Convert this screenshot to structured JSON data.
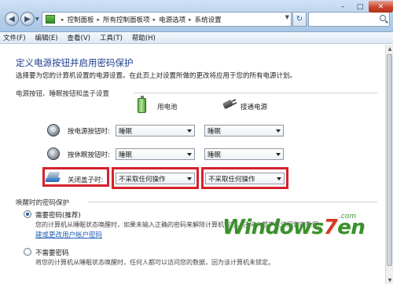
{
  "window": {
    "breadcrumbs": [
      "控制面板",
      "所有控制面板项",
      "电源选项",
      "系统设置"
    ],
    "controls": {
      "minimize": "–",
      "maximize": "□",
      "close": "✕"
    }
  },
  "menu": [
    "文件(F)",
    "编辑(E)",
    "查看(V)",
    "工具(T)",
    "帮助(H)"
  ],
  "page": {
    "title": "定义电源按钮并启用密码保护",
    "description": "选择要为您的计算机设置的电源设置。在此页上对设置所做的更改将应用于您的所有电源计划。"
  },
  "section_buttons": {
    "label": "电源按钮、睡眠按钮和盖子设置",
    "col_battery": "用电池",
    "col_plugged": "接通电源",
    "rows": [
      {
        "label": "按电源按钮时:",
        "battery": "睡眠",
        "plugged": "睡眠"
      },
      {
        "label": "按休眠按钮时:",
        "battery": "睡眠",
        "plugged": "睡眠"
      },
      {
        "label": "关闭盖子时:",
        "battery": "不采取任何操作",
        "plugged": "不采取任何操作"
      }
    ]
  },
  "section_password": {
    "label": "唤醒时的密码保护",
    "option1": {
      "label": "需要密码(推荐)",
      "desc": "您的计算机从睡眠状态唤醒时，如果未输入正确的密码来解除计算机锁定，任何人都不能访问您的数据。",
      "link": "建或更改用户帐户密码",
      "checked": true
    },
    "option2": {
      "label": "不需要密码",
      "desc": "将您的计算机从睡眠状态唤醒时，任何人都可以访问您的数据，因为该计算机未锁定。",
      "checked": false
    }
  },
  "watermark": {
    "brand": "Windows",
    "seven": "7",
    "suffix": "en",
    "com": ".com"
  },
  "colors": {
    "highlight_border": "#d6212b",
    "title": "#1c3f8d",
    "link": "#1f5fb6"
  }
}
